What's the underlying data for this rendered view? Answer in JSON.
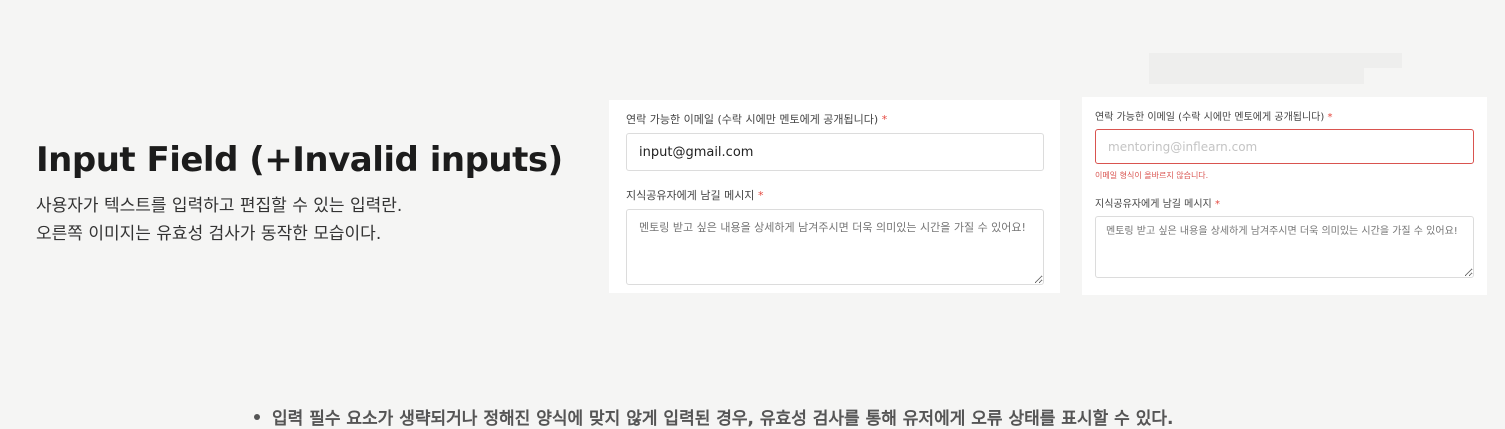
{
  "intro": {
    "title": "Input Field (+Invalid inputs)",
    "line1": "사용자가 텍스트를 입력하고 편집할 수 있는 입력란.",
    "line2": "오른쪽 이미지는 유효성 검사가 동작한 모습이다."
  },
  "valid_form": {
    "email_label": "연락 가능한 이메일 (수락 시에만 멘토에게 공개됩니다)",
    "email_value": "input@gmail.com",
    "message_label": "지식공유자에게 남길 메시지",
    "message_placeholder": "멘토링 받고 싶은 내용을 상세하게 남겨주시면 더욱 의미있는 시간을 가질 수 있어요!",
    "required_mark": "*"
  },
  "invalid_form": {
    "email_label": "연락 가능한 이메일 (수락 시에만 멘토에게 공개됩니다)",
    "email_placeholder": "mentoring@inflearn.com",
    "error_text": "이메일 형식이 올바르지 않습니다.",
    "message_label": "지식공유자에게 남길 메시지",
    "message_placeholder": "멘토링 받고 싶은 내용을 상세하게 남겨주시면 더욱 의미있는 시간을 가질 수 있어요!",
    "required_mark": "*"
  },
  "note": {
    "text": "입력 필수 요소가 생략되거나 정해진 양식에 맞지 않게 입력된 경우, 유효성 검사를 통해 유저에게 오류 상태를 표시할 수 있다."
  },
  "colors": {
    "error": "#d9534f",
    "required": "#e5483f",
    "background": "#f5f5f4"
  }
}
